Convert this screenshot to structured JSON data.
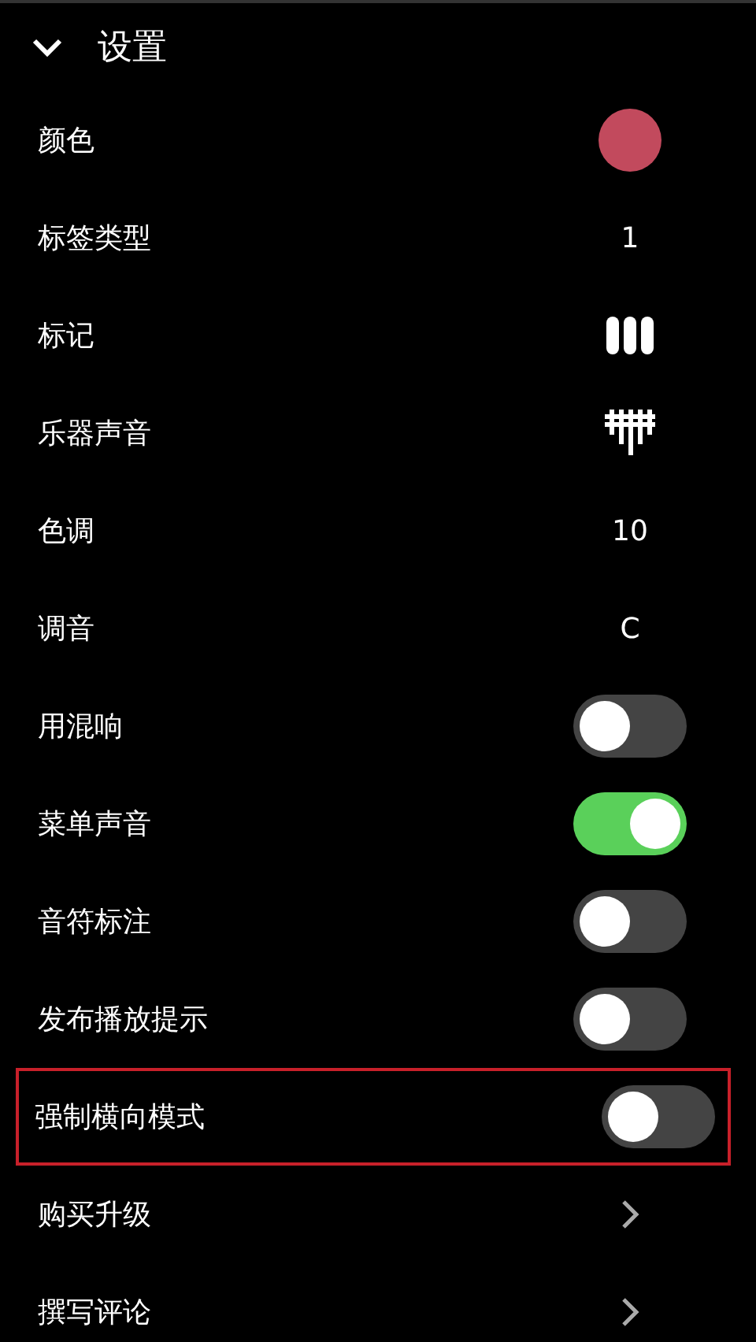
{
  "header": {
    "title": "设置",
    "expanded": true
  },
  "settings": [
    {
      "label": "颜色",
      "kind": "color",
      "color": "#c24a5d"
    },
    {
      "label": "标签类型",
      "kind": "text",
      "value": "1"
    },
    {
      "label": "标记",
      "kind": "tally"
    },
    {
      "label": "乐器声音",
      "kind": "kalimba"
    },
    {
      "label": "色调",
      "kind": "text",
      "value": "10"
    },
    {
      "label": "调音",
      "kind": "text",
      "value": "C"
    },
    {
      "label": "用混响",
      "kind": "toggle",
      "on": false
    },
    {
      "label": "菜单声音",
      "kind": "toggle",
      "on": true
    },
    {
      "label": "音符标注",
      "kind": "toggle",
      "on": false
    },
    {
      "label": "发布播放提示",
      "kind": "toggle",
      "on": false
    },
    {
      "label": "强制横向模式",
      "kind": "toggle",
      "on": false,
      "highlighted": true
    },
    {
      "label": "购买升级",
      "kind": "link"
    },
    {
      "label": "撰写评论",
      "kind": "link"
    }
  ]
}
